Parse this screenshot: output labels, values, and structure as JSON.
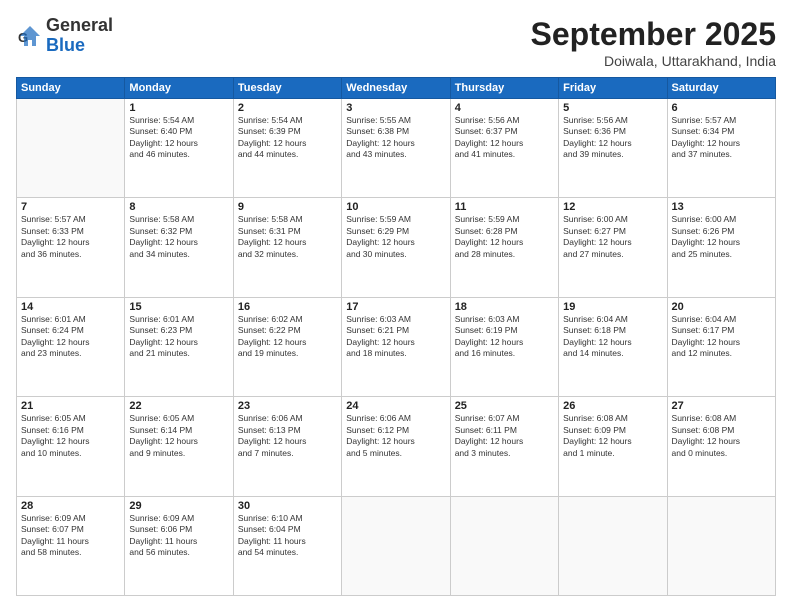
{
  "header": {
    "logo_line1": "General",
    "logo_line2": "Blue",
    "month": "September 2025",
    "location": "Doiwala, Uttarakhand, India"
  },
  "weekdays": [
    "Sunday",
    "Monday",
    "Tuesday",
    "Wednesday",
    "Thursday",
    "Friday",
    "Saturday"
  ],
  "weeks": [
    [
      {
        "day": "",
        "info": ""
      },
      {
        "day": "1",
        "info": "Sunrise: 5:54 AM\nSunset: 6:40 PM\nDaylight: 12 hours\nand 46 minutes."
      },
      {
        "day": "2",
        "info": "Sunrise: 5:54 AM\nSunset: 6:39 PM\nDaylight: 12 hours\nand 44 minutes."
      },
      {
        "day": "3",
        "info": "Sunrise: 5:55 AM\nSunset: 6:38 PM\nDaylight: 12 hours\nand 43 minutes."
      },
      {
        "day": "4",
        "info": "Sunrise: 5:56 AM\nSunset: 6:37 PM\nDaylight: 12 hours\nand 41 minutes."
      },
      {
        "day": "5",
        "info": "Sunrise: 5:56 AM\nSunset: 6:36 PM\nDaylight: 12 hours\nand 39 minutes."
      },
      {
        "day": "6",
        "info": "Sunrise: 5:57 AM\nSunset: 6:34 PM\nDaylight: 12 hours\nand 37 minutes."
      }
    ],
    [
      {
        "day": "7",
        "info": "Sunrise: 5:57 AM\nSunset: 6:33 PM\nDaylight: 12 hours\nand 36 minutes."
      },
      {
        "day": "8",
        "info": "Sunrise: 5:58 AM\nSunset: 6:32 PM\nDaylight: 12 hours\nand 34 minutes."
      },
      {
        "day": "9",
        "info": "Sunrise: 5:58 AM\nSunset: 6:31 PM\nDaylight: 12 hours\nand 32 minutes."
      },
      {
        "day": "10",
        "info": "Sunrise: 5:59 AM\nSunset: 6:29 PM\nDaylight: 12 hours\nand 30 minutes."
      },
      {
        "day": "11",
        "info": "Sunrise: 5:59 AM\nSunset: 6:28 PM\nDaylight: 12 hours\nand 28 minutes."
      },
      {
        "day": "12",
        "info": "Sunrise: 6:00 AM\nSunset: 6:27 PM\nDaylight: 12 hours\nand 27 minutes."
      },
      {
        "day": "13",
        "info": "Sunrise: 6:00 AM\nSunset: 6:26 PM\nDaylight: 12 hours\nand 25 minutes."
      }
    ],
    [
      {
        "day": "14",
        "info": "Sunrise: 6:01 AM\nSunset: 6:24 PM\nDaylight: 12 hours\nand 23 minutes."
      },
      {
        "day": "15",
        "info": "Sunrise: 6:01 AM\nSunset: 6:23 PM\nDaylight: 12 hours\nand 21 minutes."
      },
      {
        "day": "16",
        "info": "Sunrise: 6:02 AM\nSunset: 6:22 PM\nDaylight: 12 hours\nand 19 minutes."
      },
      {
        "day": "17",
        "info": "Sunrise: 6:03 AM\nSunset: 6:21 PM\nDaylight: 12 hours\nand 18 minutes."
      },
      {
        "day": "18",
        "info": "Sunrise: 6:03 AM\nSunset: 6:19 PM\nDaylight: 12 hours\nand 16 minutes."
      },
      {
        "day": "19",
        "info": "Sunrise: 6:04 AM\nSunset: 6:18 PM\nDaylight: 12 hours\nand 14 minutes."
      },
      {
        "day": "20",
        "info": "Sunrise: 6:04 AM\nSunset: 6:17 PM\nDaylight: 12 hours\nand 12 minutes."
      }
    ],
    [
      {
        "day": "21",
        "info": "Sunrise: 6:05 AM\nSunset: 6:16 PM\nDaylight: 12 hours\nand 10 minutes."
      },
      {
        "day": "22",
        "info": "Sunrise: 6:05 AM\nSunset: 6:14 PM\nDaylight: 12 hours\nand 9 minutes."
      },
      {
        "day": "23",
        "info": "Sunrise: 6:06 AM\nSunset: 6:13 PM\nDaylight: 12 hours\nand 7 minutes."
      },
      {
        "day": "24",
        "info": "Sunrise: 6:06 AM\nSunset: 6:12 PM\nDaylight: 12 hours\nand 5 minutes."
      },
      {
        "day": "25",
        "info": "Sunrise: 6:07 AM\nSunset: 6:11 PM\nDaylight: 12 hours\nand 3 minutes."
      },
      {
        "day": "26",
        "info": "Sunrise: 6:08 AM\nSunset: 6:09 PM\nDaylight: 12 hours\nand 1 minute."
      },
      {
        "day": "27",
        "info": "Sunrise: 6:08 AM\nSunset: 6:08 PM\nDaylight: 12 hours\nand 0 minutes."
      }
    ],
    [
      {
        "day": "28",
        "info": "Sunrise: 6:09 AM\nSunset: 6:07 PM\nDaylight: 11 hours\nand 58 minutes."
      },
      {
        "day": "29",
        "info": "Sunrise: 6:09 AM\nSunset: 6:06 PM\nDaylight: 11 hours\nand 56 minutes."
      },
      {
        "day": "30",
        "info": "Sunrise: 6:10 AM\nSunset: 6:04 PM\nDaylight: 11 hours\nand 54 minutes."
      },
      {
        "day": "",
        "info": ""
      },
      {
        "day": "",
        "info": ""
      },
      {
        "day": "",
        "info": ""
      },
      {
        "day": "",
        "info": ""
      }
    ]
  ]
}
